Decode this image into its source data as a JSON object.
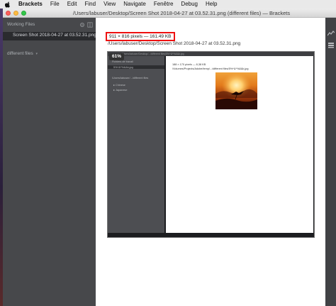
{
  "menubar": {
    "app": "Brackets",
    "items": [
      "File",
      "Edit",
      "Find",
      "View",
      "Navigate",
      "Fenêtre",
      "Debug",
      "Help"
    ]
  },
  "window": {
    "title": "/Users/labuser/Desktop/Screen Shot 2018-04-27 at 03.52.31.png (different files) — Brackets"
  },
  "sidebar": {
    "working_files_label": "Working Files",
    "open_file": "Screen Shot 2018-04-27 at 03.52.31.png",
    "project": "different files"
  },
  "image_view": {
    "info": "911 × 816 pixels — 161.49 KB",
    "path": "/Users/labuser/Desktop/Screen Shot 2018-04-27 at 03.52.31.png"
  },
  "nested_screenshot": {
    "zoom": "61%",
    "top_path": "/Users/labuser/Desktop/.../different files/5%^&*%&&k.jpg",
    "sidebar_header": "Fichiers de travail",
    "sidebar_file": "5%^&*%&&k.jpg",
    "sidebar_path": "/Users/labuser/.../different files",
    "tree_items": [
      "Chinese",
      "Japanese"
    ],
    "img_info": "188 × 170 pixels — 8,38 KB",
    "img_path": "/Volumes/Projects/Adobe/temp/.../different files/5%^&*%&&k.jpg"
  },
  "colors": {
    "sidebar_bg": "#47484b",
    "highlight_border": "#e11111",
    "right_toolbar_bg": "#414245"
  }
}
